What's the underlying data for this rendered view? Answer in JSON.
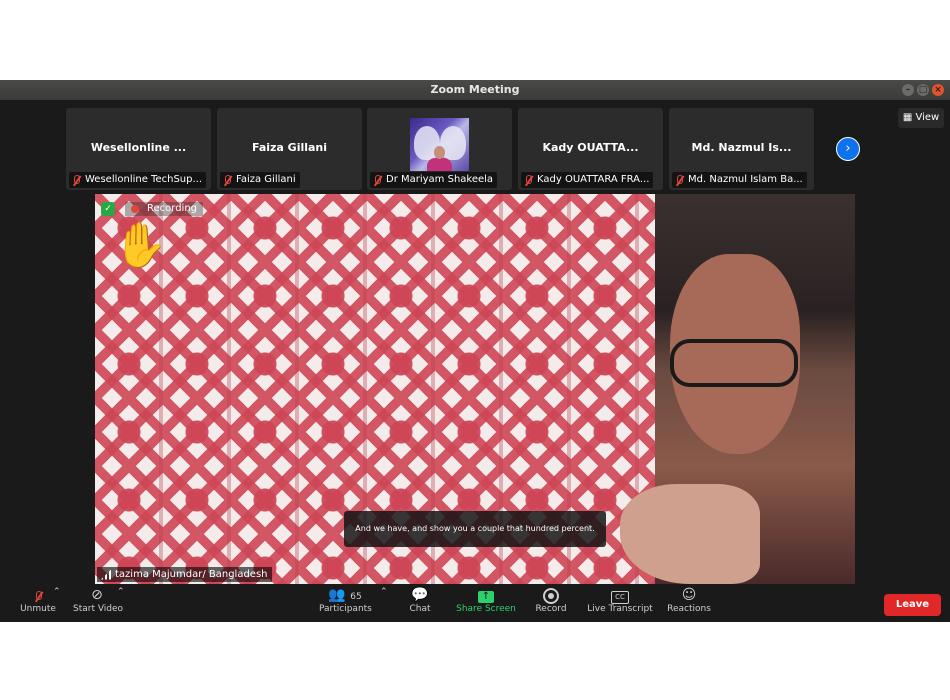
{
  "window": {
    "title": "Zoom Meeting"
  },
  "view_button": {
    "label": "View"
  },
  "participants_strip": [
    {
      "display_name": "Wesellonline ...",
      "caption": "Wesellonline TechSup..."
    },
    {
      "display_name": "Faiza Gillani",
      "caption": "Faiza Gillani"
    },
    {
      "display_name": "",
      "caption": "Dr Mariyam Shakeela"
    },
    {
      "display_name": "Kady OUATTA...",
      "caption": "Kady OUATTARA FRA..."
    },
    {
      "display_name": "Md. Nazmul Is...",
      "caption": "Md. Nazmul Islam Ba..."
    }
  ],
  "main_video": {
    "recording_label": "Recording",
    "speaker_name": "tazima Majumdar/ Bangladesh",
    "subtitle": "And we have, and show you a couple that hundred percent."
  },
  "toolbar": {
    "unmute": "Unmute",
    "start_video": "Start Video",
    "participants": "Participants",
    "participants_count": "65",
    "chat": "Chat",
    "share_screen": "Share Screen",
    "record": "Record",
    "live_transcript": "Live Transcript",
    "live_transcript_icon_text": "CC",
    "reactions": "Reactions",
    "leave": "Leave"
  },
  "colors": {
    "leave": "#e02828",
    "share": "#2fd06b",
    "accent": "#0e72ed"
  }
}
